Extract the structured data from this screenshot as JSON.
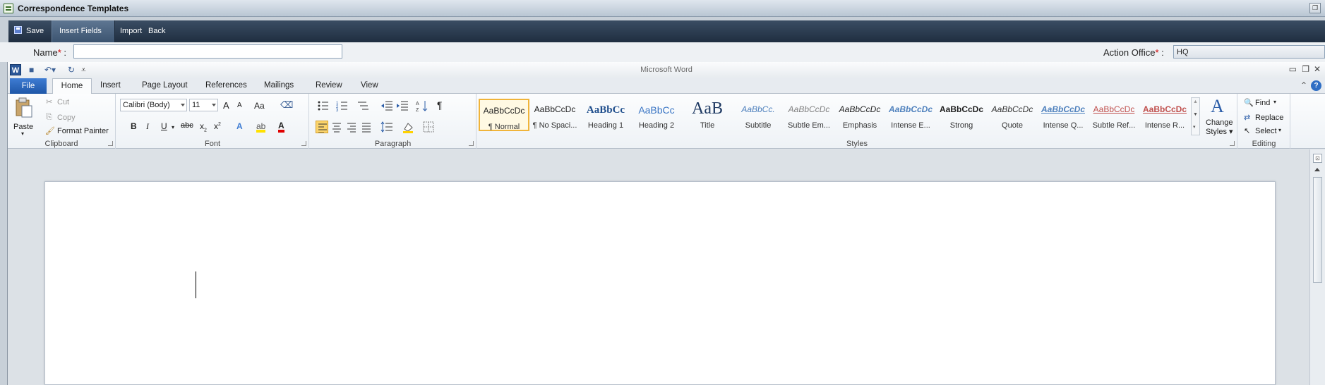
{
  "app": {
    "title": "Correspondence Templates"
  },
  "toolbar": {
    "save": "Save",
    "insert_fields": "Insert Fields",
    "import": "Import",
    "back": "Back"
  },
  "form": {
    "name_label": "Name",
    "name_required": "*",
    "name_colon": ":",
    "name_value": "",
    "office_label": "Action Office",
    "office_required": "*",
    "office_colon": ":",
    "office_value": "HQ"
  },
  "word": {
    "title": "Microsoft Word",
    "logo": "W",
    "tabs": [
      "File",
      "Home",
      "Insert",
      "Page Layout",
      "References",
      "Mailings",
      "Review",
      "View"
    ],
    "active_tab": "Home",
    "clipboard": {
      "label": "Clipboard",
      "paste": "Paste",
      "cut": "Cut",
      "copy": "Copy",
      "format_painter": "Format Painter"
    },
    "font": {
      "label": "Font",
      "family": "Calibri (Body)",
      "size": "11",
      "grow": "A",
      "shrink": "A",
      "case": "Aa",
      "bold": "B",
      "italic": "I",
      "underline": "U",
      "strike": "abc",
      "subscript": "x",
      "superscript": "x",
      "text_effects": "A",
      "font_color": "A"
    },
    "paragraph": {
      "label": "Paragraph",
      "pilcrow": "¶"
    },
    "styles": {
      "label": "Styles",
      "items": [
        {
          "sample": "AaBbCcDc",
          "name": "¶ Normal"
        },
        {
          "sample": "AaBbCcDc",
          "name": "¶ No Spaci..."
        },
        {
          "sample": "AaBbCc",
          "name": "Heading 1"
        },
        {
          "sample": "AaBbCc",
          "name": "Heading 2"
        },
        {
          "sample": "AaB",
          "name": "Title"
        },
        {
          "sample": "AaBbCc.",
          "name": "Subtitle"
        },
        {
          "sample": "AaBbCcDc",
          "name": "Subtle Em..."
        },
        {
          "sample": "AaBbCcDc",
          "name": "Emphasis"
        },
        {
          "sample": "AaBbCcDc",
          "name": "Intense E..."
        },
        {
          "sample": "AaBbCcDc",
          "name": "Strong"
        },
        {
          "sample": "AaBbCcDc",
          "name": "Quote"
        },
        {
          "sample": "AaBbCcDc",
          "name": "Intense Q..."
        },
        {
          "sample": "AaBbCcDc",
          "name": "Subtle Ref..."
        },
        {
          "sample": "AaBbCcDc",
          "name": "Intense R..."
        }
      ],
      "change_styles": "Change",
      "change_styles_2": "Styles"
    },
    "editing": {
      "label": "Editing",
      "find": "Find",
      "replace": "Replace",
      "select": "Select"
    },
    "help": "?"
  },
  "colors": {
    "toolbar": "#2a3b50",
    "file_tab": "#2b5da8",
    "selected_style": "#f0b43a"
  }
}
